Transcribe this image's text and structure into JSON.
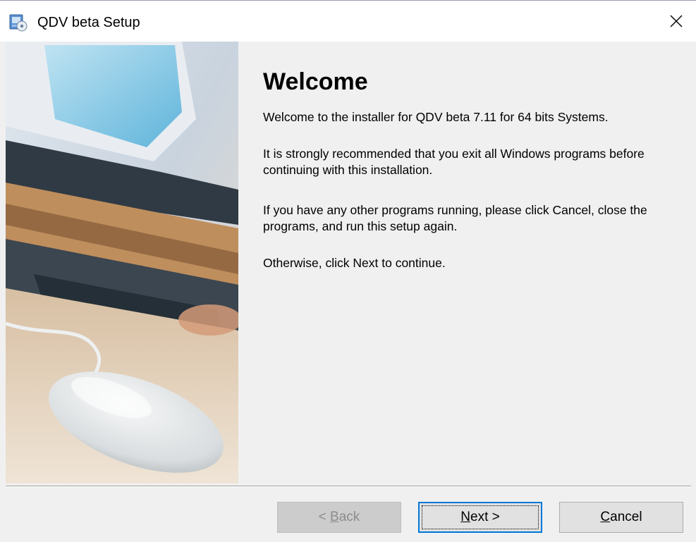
{
  "window": {
    "title": "QDV beta Setup"
  },
  "welcome": {
    "heading": "Welcome",
    "paragraphs": [
      "Welcome to the installer for QDV beta 7.11 for 64 bits Systems.",
      "It is strongly recommended that you exit all Windows programs before continuing with this installation.",
      "If you have any other programs running, please click Cancel, close the programs, and run this setup again.",
      "Otherwise, click Next to continue."
    ]
  },
  "buttons": {
    "back": {
      "mnemonic": "B",
      "rest": "ack",
      "prefix": "< ",
      "enabled": false
    },
    "next": {
      "mnemonic": "N",
      "rest": "ext >",
      "enabled": true
    },
    "cancel": {
      "mnemonic": "C",
      "rest": "ancel",
      "enabled": true
    }
  },
  "icons": {
    "app": "installer-icon",
    "close": "close-icon",
    "side_image": "desk-computer-mouse-photo"
  },
  "colors": {
    "dialog_bg": "#f0f0f0",
    "titlebar_bg": "#ffffff",
    "focus_accent": "#0078d7"
  }
}
